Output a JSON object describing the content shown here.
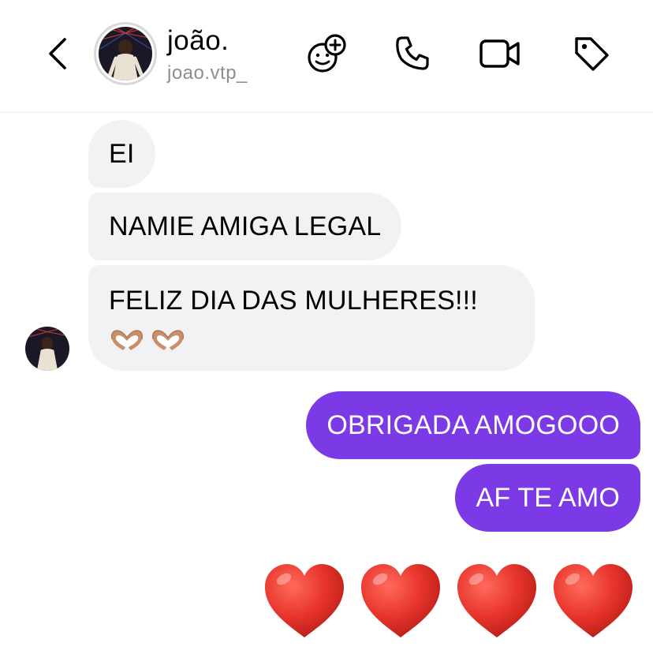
{
  "header": {
    "contact_name": "joão.",
    "contact_handle": "joao.vtp_",
    "icons": {
      "back": "chevron-left-icon",
      "effects": "smiley-plus-icon",
      "call": "phone-icon",
      "video": "video-camera-icon",
      "tag": "tag-icon"
    }
  },
  "messages": {
    "incoming": [
      {
        "text": "EI"
      },
      {
        "text": "NAMIE AMIGA LEGAL"
      },
      {
        "text": "FELIZ DIA DAS MULHERES!!!",
        "emoji": "heart-hands-emoji x2"
      }
    ],
    "outgoing": [
      {
        "text": "OBRIGADA AMOGOOO"
      },
      {
        "text": "AF TE AMO"
      }
    ],
    "emoji_message": "red-heart-emoji x4"
  },
  "colors": {
    "outgoing_bubble": "#7b3ae5",
    "incoming_bubble": "#f2f2f4",
    "heart": "#e8352c",
    "handle_gray": "#8e8e8e"
  }
}
